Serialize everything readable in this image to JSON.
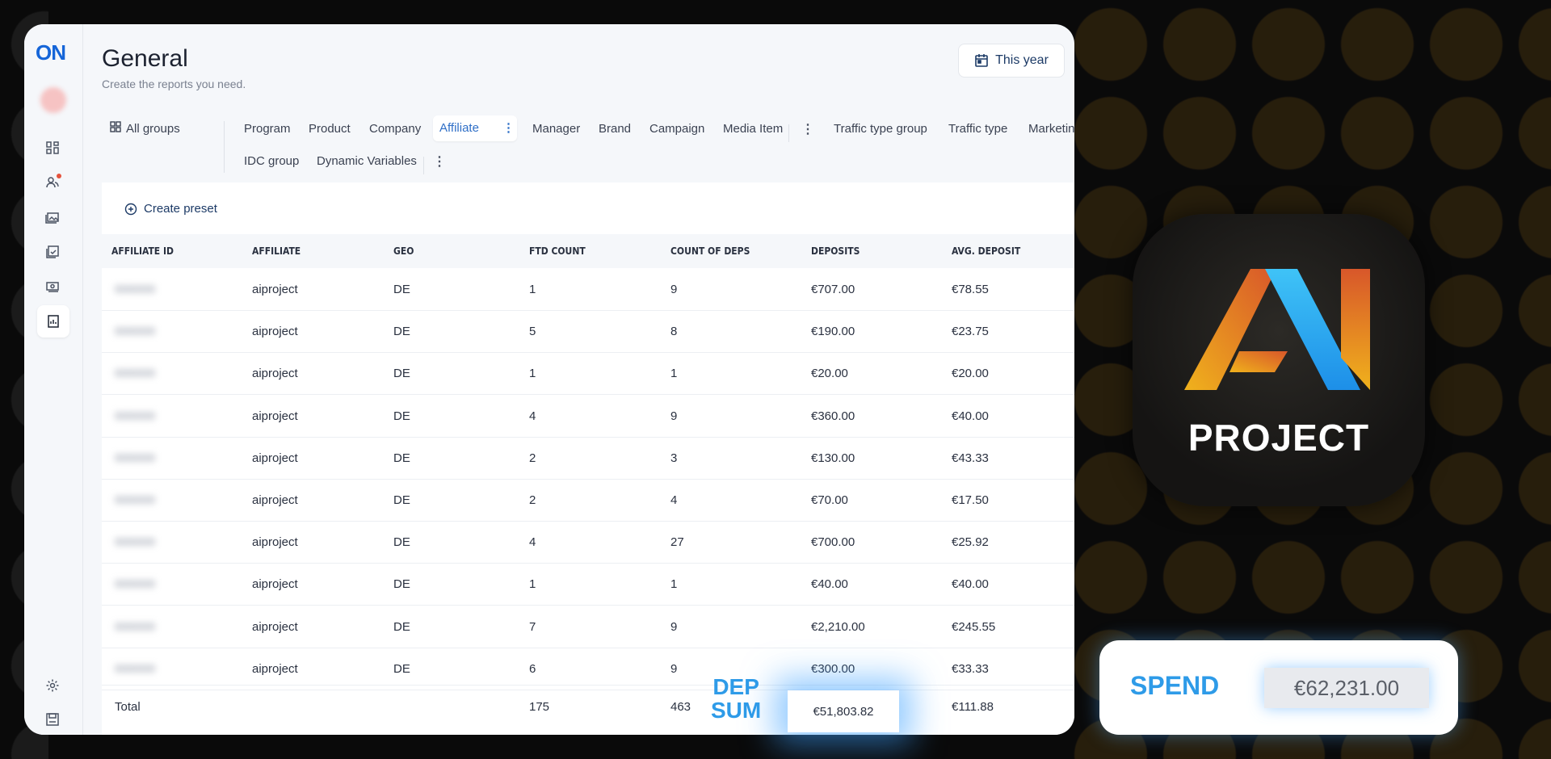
{
  "app": {
    "logo": "ON"
  },
  "header": {
    "title": "General",
    "subtitle": "Create the reports you need.",
    "date_range": "This year"
  },
  "tabs": {
    "all_groups": "All groups",
    "row1": [
      "Program",
      "Product",
      "Company",
      "Affiliate"
    ],
    "row1b": [
      "Manager",
      "Brand",
      "Campaign",
      "Media Item"
    ],
    "row1c": [
      "Traffic type group",
      "Traffic type",
      "Marketing so"
    ],
    "row2": [
      "IDC group",
      "Dynamic Variables"
    ],
    "active": "Affiliate"
  },
  "table": {
    "create_preset": "Create preset",
    "columns": [
      "AFFILIATE ID",
      "AFFILIATE",
      "GEO",
      "FTD COUNT",
      "COUNT OF DEPS",
      "DEPOSITS",
      "AVG. DEPOSIT"
    ],
    "rows": [
      {
        "id": "000000",
        "affiliate": "aiproject",
        "geo": "DE",
        "ftd": "1",
        "deps": "9",
        "deposits": "€707.00",
        "avg": "€78.55"
      },
      {
        "id": "000000",
        "affiliate": "aiproject",
        "geo": "DE",
        "ftd": "5",
        "deps": "8",
        "deposits": "€190.00",
        "avg": "€23.75"
      },
      {
        "id": "000000",
        "affiliate": "aiproject",
        "geo": "DE",
        "ftd": "1",
        "deps": "1",
        "deposits": "€20.00",
        "avg": "€20.00"
      },
      {
        "id": "000000",
        "affiliate": "aiproject",
        "geo": "DE",
        "ftd": "4",
        "deps": "9",
        "deposits": "€360.00",
        "avg": "€40.00"
      },
      {
        "id": "000000",
        "affiliate": "aiproject",
        "geo": "DE",
        "ftd": "2",
        "deps": "3",
        "deposits": "€130.00",
        "avg": "€43.33"
      },
      {
        "id": "000000",
        "affiliate": "aiproject",
        "geo": "DE",
        "ftd": "2",
        "deps": "4",
        "deposits": "€70.00",
        "avg": "€17.50"
      },
      {
        "id": "000000",
        "affiliate": "aiproject",
        "geo": "DE",
        "ftd": "4",
        "deps": "27",
        "deposits": "€700.00",
        "avg": "€25.92"
      },
      {
        "id": "000000",
        "affiliate": "aiproject",
        "geo": "DE",
        "ftd": "1",
        "deps": "1",
        "deposits": "€40.00",
        "avg": "€40.00"
      },
      {
        "id": "000000",
        "affiliate": "aiproject",
        "geo": "DE",
        "ftd": "7",
        "deps": "9",
        "deposits": "€2,210.00",
        "avg": "€245.55"
      },
      {
        "id": "000000",
        "affiliate": "aiproject",
        "geo": "DE",
        "ftd": "6",
        "deps": "9",
        "deposits": "€300.00",
        "avg": "€33.33"
      }
    ],
    "total": {
      "label": "Total",
      "ftd": "175",
      "deps": "463",
      "deposits": "€51,803.82",
      "avg": "€111.88"
    }
  },
  "overlay": {
    "dep_label_1": "DEP",
    "dep_label_2": "SUM",
    "brand_word": "PROJECT",
    "spend_label": "SPEND",
    "spend_value": "€62,231.00"
  },
  "colors": {
    "accent": "#2e9be8",
    "brand_orange": "#e0892a",
    "brand_blue": "#26a6f0"
  }
}
